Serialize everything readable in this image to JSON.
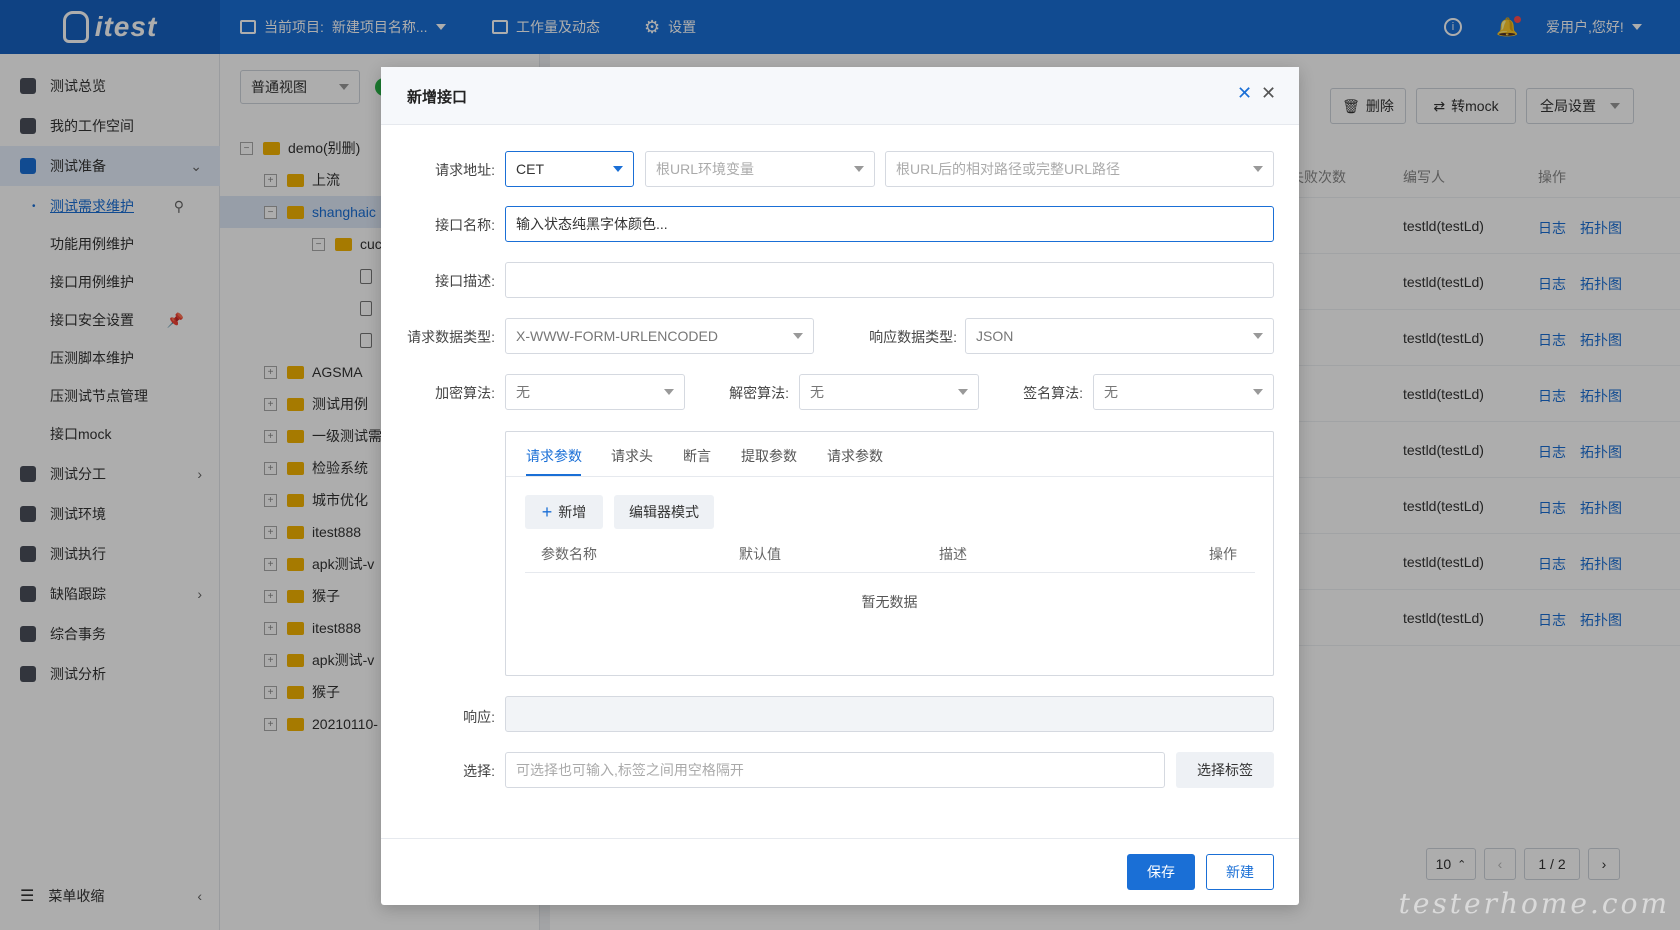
{
  "app": {
    "logo": "itest"
  },
  "topbar": {
    "project_label": "当前项目:",
    "project_name": "新建项目名称...",
    "workload": "工作量及动态",
    "settings": "设置",
    "greeting": "爱用户,您好!"
  },
  "sidebar": {
    "items": [
      {
        "label": "测试总览"
      },
      {
        "label": "我的工作空间"
      },
      {
        "label": "测试准备"
      },
      {
        "label": "测试需求维护"
      },
      {
        "label": "功能用例维护"
      },
      {
        "label": "接口用例维护"
      },
      {
        "label": "接口安全设置"
      },
      {
        "label": "压测脚本维护"
      },
      {
        "label": "压测试节点管理"
      },
      {
        "label": "接口mock"
      },
      {
        "label": "测试分工"
      },
      {
        "label": "测试环境"
      },
      {
        "label": "测试执行"
      },
      {
        "label": "缺陷跟踪"
      },
      {
        "label": "综合事务"
      },
      {
        "label": "测试分析"
      }
    ],
    "collapse": "菜单收缩"
  },
  "tree": {
    "view_select": "普通视图",
    "nodes": [
      {
        "label": "demo(别删)"
      },
      {
        "label": "上流"
      },
      {
        "label": "shanghaic"
      },
      {
        "label": "cuc"
      },
      {
        "label": ""
      },
      {
        "label": ""
      },
      {
        "label": ""
      },
      {
        "label": "AGSMA"
      },
      {
        "label": "测试用例"
      },
      {
        "label": "一级测试需"
      },
      {
        "label": "检验系统"
      },
      {
        "label": "城市优化"
      },
      {
        "label": "itest888"
      },
      {
        "label": "apk测试-v"
      },
      {
        "label": "猴子"
      },
      {
        "label": "itest888"
      },
      {
        "label": "apk测试-v"
      },
      {
        "label": "猴子"
      },
      {
        "label": "20210110-"
      }
    ]
  },
  "table": {
    "toolbar": {
      "delete": "删除",
      "to_mock": "转mock",
      "global": "全局设置"
    },
    "headers": {
      "fail": "失败次数",
      "author": "编写人",
      "ops": "操作"
    },
    "rows": [
      {
        "author": "testld(testLd)",
        "log": "日志",
        "topo": "拓扑图"
      },
      {
        "author": "testld(testLd)",
        "log": "日志",
        "topo": "拓扑图"
      },
      {
        "author": "testld(testLd)",
        "log": "日志",
        "topo": "拓扑图"
      },
      {
        "author": "testld(testLd)",
        "log": "日志",
        "topo": "拓扑图"
      },
      {
        "author": "testld(testLd)",
        "log": "日志",
        "topo": "拓扑图"
      },
      {
        "author": "testld(testLd)",
        "log": "日志",
        "topo": "拓扑图"
      },
      {
        "author": "testld(testLd)",
        "log": "日志",
        "topo": "拓扑图"
      },
      {
        "author": "testld(testLd)",
        "log": "日志",
        "topo": "拓扑图"
      }
    ],
    "pager": {
      "size": "10",
      "page": "1 / 2"
    }
  },
  "modal": {
    "title": "新增接口",
    "labels": {
      "url": "请求地址:",
      "name": "接口名称:",
      "desc": "接口描述:",
      "req_type": "请求数据类型:",
      "resp_type": "响应数据类型:",
      "encrypt": "加密算法:",
      "decrypt": "解密算法:",
      "sign": "签名算法:",
      "response": "响应:",
      "select": "选择:"
    },
    "method": "CET",
    "env_placeholder": "根URL环境变量",
    "path_placeholder": "根URL后的相对路径或完整URL路径",
    "name_value": "输入状态纯黑字体颜色...",
    "req_type_value": "X-WWW-FORM-URLENCODED",
    "resp_type_value": "JSON",
    "encrypt_value": "无",
    "decrypt_value": "无",
    "sign_value": "无",
    "tabs": [
      "请求参数",
      "请求头",
      "断言",
      "提取参数",
      "请求参数"
    ],
    "add_btn": "新增",
    "editor_btn": "编辑器模式",
    "columns": [
      "参数名称",
      "默认值",
      "描述",
      "操作"
    ],
    "empty": "暂无数据",
    "tag_placeholder": "可选择也可输入,标签之间用空格隔开",
    "tag_btn": "选择标签",
    "save": "保存",
    "new": "新建"
  },
  "watermark": "testerhome.com",
  "colors": {
    "primary": "#1a6fd6"
  }
}
